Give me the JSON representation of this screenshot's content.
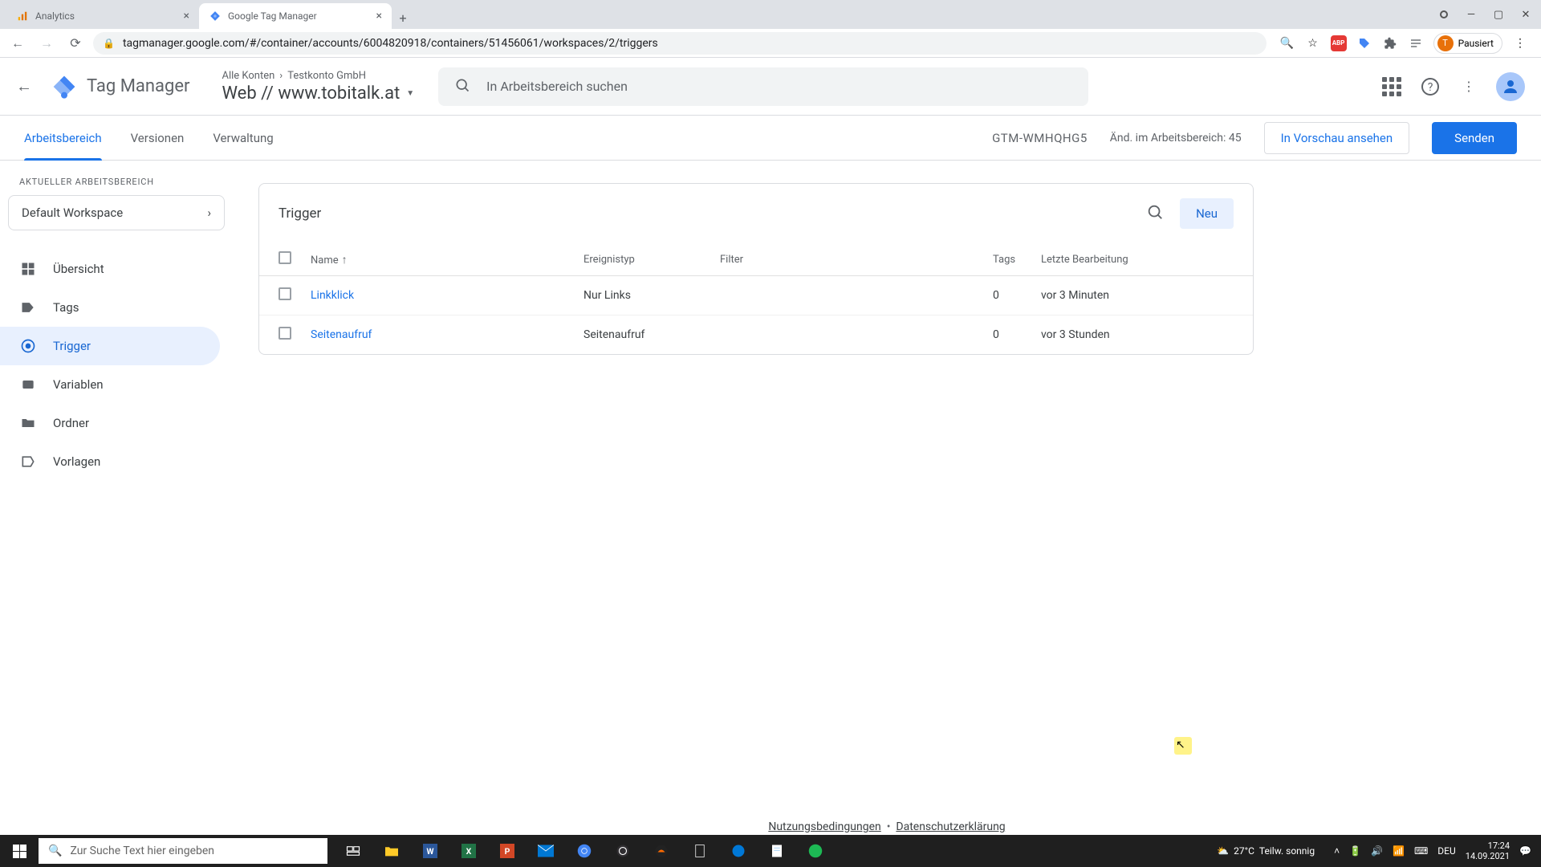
{
  "browser": {
    "tabs": [
      {
        "title": "Analytics",
        "active": false
      },
      {
        "title": "Google Tag Manager",
        "active": true
      }
    ],
    "url": "tagmanager.google.com/#/container/accounts/6004820918/containers/51456061/workspaces/2/triggers",
    "profile_status": "Pausiert",
    "profile_initial": "T"
  },
  "header": {
    "app_name": "Tag Manager",
    "breadcrumb_all": "Alle Konten",
    "breadcrumb_account": "Testkonto GmbH",
    "container_name": "Web // www.tobitalk.at",
    "search_placeholder": "In Arbeitsbereich suchen"
  },
  "secnav": {
    "tabs": [
      "Arbeitsbereich",
      "Versionen",
      "Verwaltung"
    ],
    "container_id": "GTM-WMHQHG5",
    "changes": "Änd. im Arbeitsbereich: 45",
    "preview": "In Vorschau ansehen",
    "send": "Senden"
  },
  "sidebar": {
    "ws_label": "AKTUELLER ARBEITSBEREICH",
    "ws_name": "Default Workspace",
    "items": [
      {
        "label": "Übersicht"
      },
      {
        "label": "Tags"
      },
      {
        "label": "Trigger"
      },
      {
        "label": "Variablen"
      },
      {
        "label": "Ordner"
      },
      {
        "label": "Vorlagen"
      }
    ]
  },
  "card": {
    "title": "Trigger",
    "new_btn": "Neu",
    "columns": {
      "name": "Name",
      "event": "Ereignistyp",
      "filter": "Filter",
      "tags": "Tags",
      "edit": "Letzte Bearbeitung"
    },
    "rows": [
      {
        "name": "Linkklick",
        "event": "Nur Links",
        "filter": "",
        "tags": "0",
        "edit": "vor 3 Minuten"
      },
      {
        "name": "Seitenaufruf",
        "event": "Seitenaufruf",
        "filter": "",
        "tags": "0",
        "edit": "vor 3 Stunden"
      }
    ]
  },
  "footer": {
    "terms": "Nutzungsbedingungen",
    "privacy": "Datenschutzerklärung"
  },
  "taskbar": {
    "search_placeholder": "Zur Suche Text hier eingeben",
    "weather_temp": "27°C",
    "weather_desc": "Teilw. sonnig",
    "lang": "DEU",
    "time": "17:24",
    "date": "14.09.2021"
  }
}
